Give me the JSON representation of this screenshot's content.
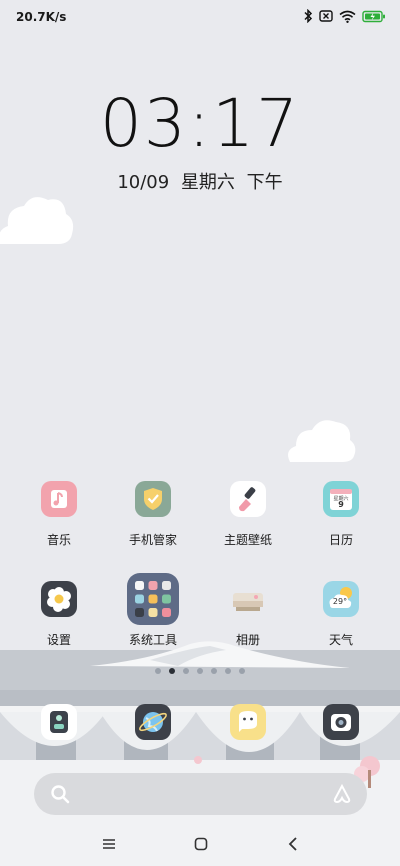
{
  "status_bar": {
    "net_speed": "20.7K/s",
    "icons": [
      "bluetooth-icon",
      "sim-no-signal-icon",
      "wifi-icon",
      "battery-charging-icon"
    ]
  },
  "lock": {
    "time": "03:17",
    "date": "10/09",
    "weekday": "星期六",
    "period": "下午"
  },
  "apps_row1": [
    {
      "label": "音乐",
      "icon": "music-icon",
      "color": "#f2a3ad"
    },
    {
      "label": "手机管家",
      "icon": "security-icon",
      "color": "#8aa897"
    },
    {
      "label": "主题壁纸",
      "icon": "theme-icon",
      "color": "#ffffff"
    },
    {
      "label": "日历",
      "icon": "calendar-icon",
      "color": "#7fd3d6"
    }
  ],
  "apps_row2": [
    {
      "label": "设置",
      "icon": "settings-icon",
      "color": "#3d4149"
    },
    {
      "label": "系统工具",
      "icon": "folder-icon",
      "color": "#5e6b86"
    },
    {
      "label": "相册",
      "icon": "gallery-icon",
      "color": "#e8dfd2"
    },
    {
      "label": "天气",
      "icon": "weather-icon",
      "color": "#9ad6e6"
    }
  ],
  "calendar_icon": {
    "month": "星期六",
    "day": "9"
  },
  "weather_icon": {
    "temp": "29°"
  },
  "page_indicator": {
    "count": 7,
    "active": 1
  },
  "dock": [
    "phone-icon",
    "browser-icon",
    "messages-icon",
    "camera-icon"
  ],
  "colors": {
    "background": "#e9eaee",
    "accent": "#2b2f36"
  }
}
